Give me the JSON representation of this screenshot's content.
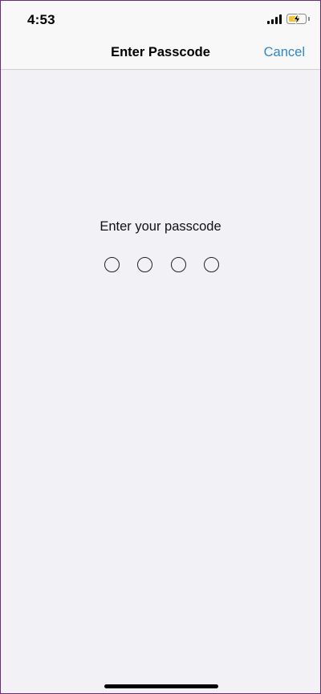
{
  "status_bar": {
    "time": "4:53",
    "signal_icon": "cellular-signal-icon",
    "battery_icon": "battery-charging-icon",
    "battery_color": "#f4c430"
  },
  "nav": {
    "title": "Enter Passcode",
    "cancel_label": "Cancel",
    "accent_color": "#2f86c9"
  },
  "passcode": {
    "prompt": "Enter your passcode",
    "digit_count": 4,
    "entered_count": 0
  }
}
